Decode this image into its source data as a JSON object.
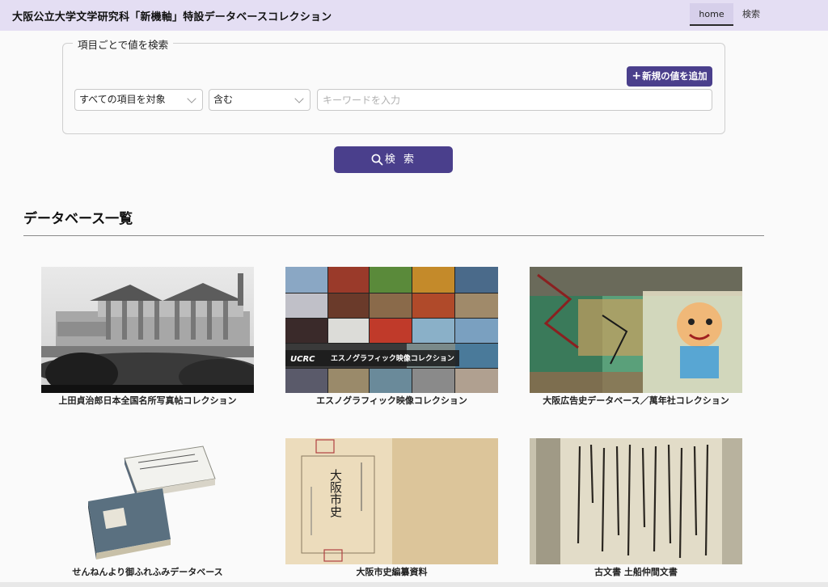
{
  "header": {
    "title": "大阪公立大学文学研究科「新機軸」特設データベースコレクション",
    "nav": {
      "home": "home",
      "search": "検索"
    }
  },
  "search_form": {
    "legend": "項目ごとで値を検索",
    "add_button": "新規の値を追加",
    "add_icon": "plus-icon",
    "field_select": "すべての項目を対象",
    "operator_select": "含む",
    "keyword_placeholder": "キーワードを入力",
    "keyword_value": "",
    "search_button": "検 索",
    "search_icon": "search-icon"
  },
  "database_list": {
    "title": "データベース一覧",
    "items": [
      {
        "caption": "上田貞治郎日本全国名所写真帖コレクション",
        "image": "historic-building-photo"
      },
      {
        "caption": "エスノグラフィック映像コレクション",
        "image": "photo-collage",
        "overlay_brand": "UCRC",
        "overlay_text": "エスノグラフィック映像コレクション"
      },
      {
        "caption": "大阪広告史データベース／萬年社コレクション",
        "image": "advertising-collage"
      },
      {
        "caption": "せんねんより御ふれふみデータベース",
        "image": "old-books"
      },
      {
        "caption": "大阪市史編纂資料",
        "image": "book-cover",
        "cover_title": "大阪市史"
      },
      {
        "caption": "古文書 土船仲間文書",
        "image": "manuscript-scroll"
      }
    ]
  },
  "colors": {
    "header_bg": "#e4def3",
    "accent": "#4a3f8c"
  }
}
